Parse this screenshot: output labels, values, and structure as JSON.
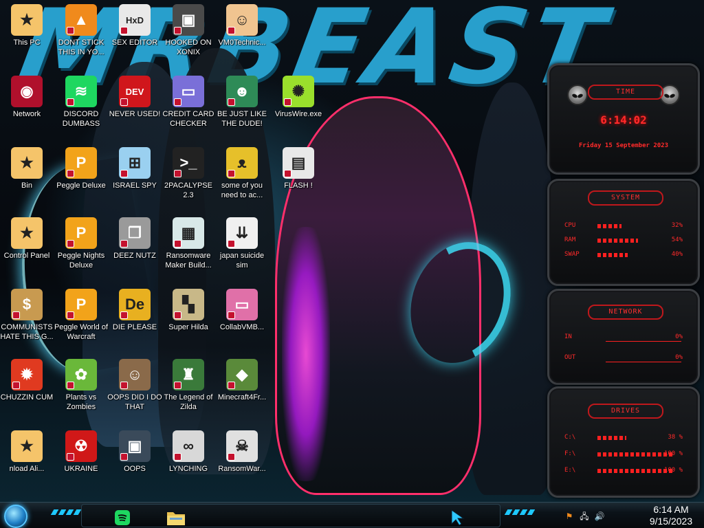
{
  "wallpaper": {
    "headline": "MRBEAST"
  },
  "desktop_icons": [
    {
      "label": "This PC",
      "icon": "star-character-icon",
      "color": "#f5c46a"
    },
    {
      "label": "DONT STICK THIS IN YO...",
      "icon": "vlc-cone-icon",
      "color": "#f08a1c"
    },
    {
      "label": "SEX EDITOR",
      "icon": "hxd-editor-icon",
      "color": "#e9e9e9"
    },
    {
      "label": "HOOKED ON XONIX",
      "icon": "xonix-game-icon",
      "color": "#4a4a4a"
    },
    {
      "label": "VM0Technic...",
      "icon": "doctor-avatar-icon",
      "color": "#f0c490"
    },
    {
      "label": "Network",
      "icon": "network-globe-icon",
      "color": "#b0102c"
    },
    {
      "label": "DISCORD DUMBASS",
      "icon": "spotify-logo-icon",
      "color": "#1ed760"
    },
    {
      "label": "NEVER USED!",
      "icon": "devcpp-icon",
      "color": "#d0161c"
    },
    {
      "label": "CREDIT CARD CHECKER",
      "icon": "credit-card-icon",
      "color": "#7a6fd8"
    },
    {
      "label": "BE JUST LIKE THE DUDE!",
      "icon": "elf-face-icon",
      "color": "#2e8b57"
    },
    {
      "label": "VirusWire.exe",
      "icon": "lime-icon",
      "color": "#9adf2c"
    },
    {
      "label": "Bin",
      "icon": "star-character-icon",
      "color": "#f5c46a"
    },
    {
      "label": "Peggle Deluxe",
      "icon": "peggle-icon",
      "color": "#f2a31a"
    },
    {
      "label": "ISRAEL SPY",
      "icon": "computer-network-icon",
      "color": "#9ad0f0"
    },
    {
      "label": "2PACALYPSE 2.3",
      "icon": "terminal-icon",
      "color": "#222222"
    },
    {
      "label": "some of you need to ac...",
      "icon": "beaver-icon",
      "color": "#e6c02a"
    },
    {
      "label": "FLASH !",
      "icon": "file-document-icon",
      "color": "#e8e8e8"
    },
    {
      "label": "Control Panel",
      "icon": "star-character-icon",
      "color": "#f5c46a"
    },
    {
      "label": "Peggle Nights Deluxe",
      "icon": "peggle-icon",
      "color": "#f2a31a"
    },
    {
      "label": "DEEZ NUTZ",
      "icon": "stacked-windows-icon",
      "color": "#9a9a9a"
    },
    {
      "label": "Ransomware Maker Build...",
      "icon": "window-app-icon",
      "color": "#d8e8e8"
    },
    {
      "label": "japan suicide sim",
      "icon": "file-installer-icon",
      "color": "#f0f0f0"
    },
    {
      "label": "COMMUNISTS HATE THIS G...",
      "icon": "money-bag-icon",
      "color": "#c89a50"
    },
    {
      "label": "Peggle World of Warcraft",
      "icon": "peggle-icon",
      "color": "#f2a31a"
    },
    {
      "label": "DIE PLEASE",
      "icon": "de-icon",
      "color": "#e8b020"
    },
    {
      "label": "Super Hilda",
      "icon": "pixel-dog-icon",
      "color": "#c8b888"
    },
    {
      "label": "CollabVMB...",
      "icon": "monitor-pink-icon",
      "color": "#e070a8"
    },
    {
      "label": "CHUZZIN CUM",
      "icon": "chuzzle-icon",
      "color": "#e03a20"
    },
    {
      "label": "Plants vs Zombies",
      "icon": "flower-pot-icon",
      "color": "#6ab83a"
    },
    {
      "label": "OOPS DID I DO THAT",
      "icon": "portrait-painting-icon",
      "color": "#8a6a4a"
    },
    {
      "label": "The Legend of Zilda",
      "icon": "pixel-hero-icon",
      "color": "#3a7a3a"
    },
    {
      "label": "Minecraft4Fr...",
      "icon": "grass-block-icon",
      "color": "#5a8a3a"
    },
    {
      "label": "nload Ali...",
      "icon": "star-character-icon",
      "color": "#f5c46a"
    },
    {
      "label": "UKRAINE",
      "icon": "radiation-icon",
      "color": "#d01818"
    },
    {
      "label": "OOPS",
      "icon": "monitor-dark-icon",
      "color": "#3a4a5a"
    },
    {
      "label": "LYNCHING",
      "icon": "knot-icon",
      "color": "#d8d8d8"
    },
    {
      "label": "RansomWar...",
      "icon": "skull-icon",
      "color": "#e0e0e0"
    }
  ],
  "widgets": {
    "time": {
      "title": "TIME",
      "clock": "6:14:02",
      "date": "Friday 15 September 2023"
    },
    "system": {
      "title": "SYSTEM",
      "rows": [
        {
          "label": "CPU",
          "value": "32%",
          "level": 0.32
        },
        {
          "label": "RAM",
          "value": "54%",
          "level": 0.54
        },
        {
          "label": "SWAP",
          "value": "40%",
          "level": 0.4
        }
      ]
    },
    "network": {
      "title": "NETWORK",
      "rows": [
        {
          "label": "IN",
          "value": "0%"
        },
        {
          "label": "OUT",
          "value": "0%"
        }
      ]
    },
    "drives": {
      "title": "DRIVES",
      "rows": [
        {
          "label": "C:\\",
          "value": "38 %",
          "level": 0.38
        },
        {
          "label": "F:\\",
          "value": "100 %",
          "level": 1.0
        },
        {
          "label": "E:\\",
          "value": "100 %",
          "level": 1.0
        }
      ]
    },
    "accent_color": "#ff2a2a"
  },
  "taskbar": {
    "pinned": [
      {
        "name": "spotify",
        "icon": "spotify-logo-icon",
        "color": "#1ed760"
      },
      {
        "name": "file-explorer",
        "icon": "folder-icon",
        "color": "#e8c050"
      }
    ],
    "tray": [
      {
        "icon": "flag-icon"
      },
      {
        "icon": "network-status-icon"
      },
      {
        "icon": "volume-icon"
      }
    ],
    "clock_time": "6:14 AM",
    "clock_date": "9/15/2023"
  }
}
